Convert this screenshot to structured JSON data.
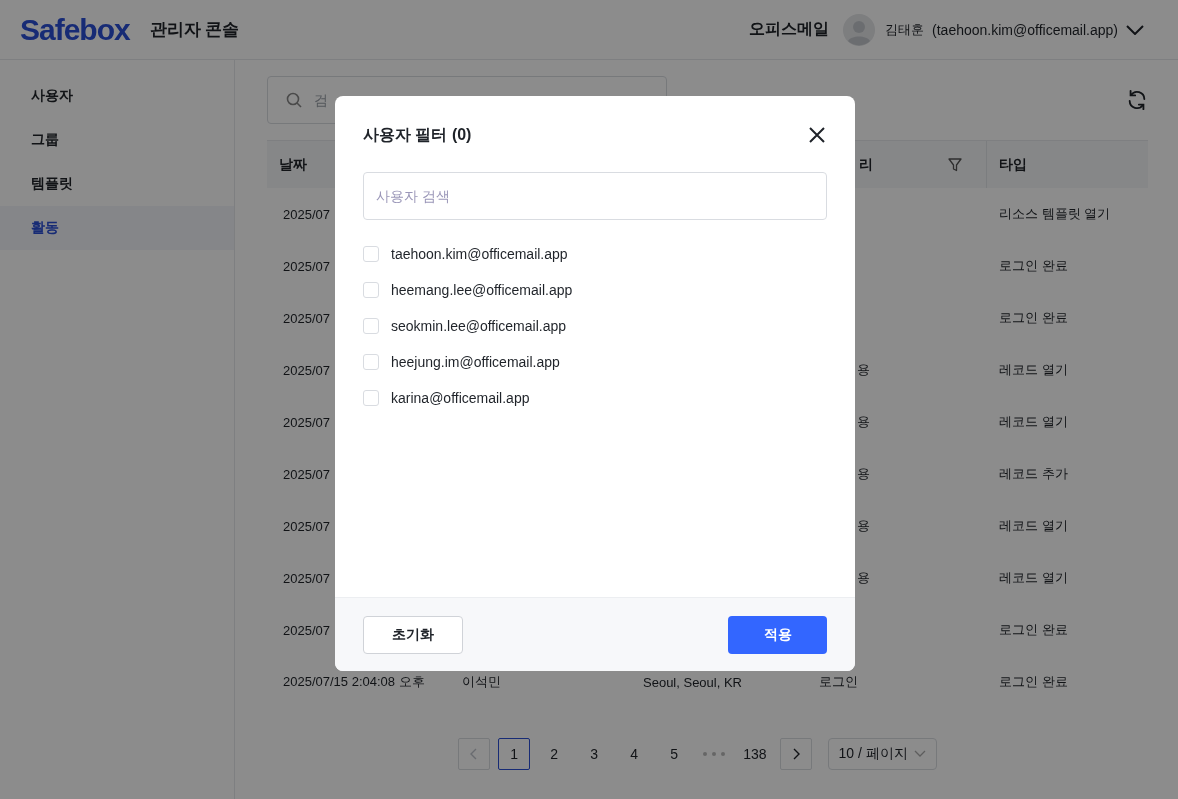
{
  "header": {
    "logo": "Safebox",
    "subtitle": "관리자 콘솔",
    "org": "오피스메일",
    "user_name": "김태훈",
    "user_email": "(taehoon.kim@officemail.app)"
  },
  "sidebar": {
    "items": [
      {
        "label": "사용자",
        "selected": false
      },
      {
        "label": "그룹",
        "selected": false
      },
      {
        "label": "템플릿",
        "selected": false
      },
      {
        "label": "활동",
        "selected": true
      }
    ]
  },
  "search": {
    "placeholder": "검"
  },
  "table": {
    "columns": {
      "date": "날짜",
      "category": "리",
      "type": "타입"
    },
    "rows": [
      {
        "date": "2025/07",
        "type": "리소스 템플릿 열기"
      },
      {
        "date": "2025/07",
        "type": "로그인 완료"
      },
      {
        "date": "2025/07",
        "type": "로그인 완료"
      },
      {
        "date": "2025/07",
        "category": "용",
        "type": "레코드 열기"
      },
      {
        "date": "2025/07",
        "category": "용",
        "type": "레코드 열기"
      },
      {
        "date": "2025/07",
        "category": "용",
        "type": "레코드 추가"
      },
      {
        "date": "2025/07",
        "category": "용",
        "type": "레코드 열기"
      },
      {
        "date": "2025/07",
        "category": "용",
        "type": "레코드 열기"
      },
      {
        "date": "2025/07",
        "type": "로그인 완료"
      },
      {
        "date": "2025/07/15 2:04:08 오후",
        "user": "이석민",
        "location": "Seoul, Seoul, KR",
        "category": "로그인",
        "type": "로그인 완료"
      }
    ]
  },
  "pagination": {
    "prev_disabled": true,
    "pages": [
      {
        "label": "1",
        "selected": true
      },
      {
        "label": "2",
        "selected": false
      },
      {
        "label": "3",
        "selected": false
      },
      {
        "label": "4",
        "selected": false
      },
      {
        "label": "5",
        "selected": false
      }
    ],
    "last_page": {
      "label": "138",
      "selected": false
    },
    "next_disabled": false,
    "page_size": "10 / 페이지"
  },
  "modal": {
    "title": "사용자 필터 (0)",
    "search_placeholder": "사용자 검색",
    "users": [
      {
        "email": "taehoon.kim@officemail.app",
        "checked": false
      },
      {
        "email": "heemang.lee@officemail.app",
        "checked": false
      },
      {
        "email": "seokmin.lee@officemail.app",
        "checked": false
      },
      {
        "email": "heejung.im@officemail.app",
        "checked": false
      },
      {
        "email": "karina@officemail.app",
        "checked": false
      }
    ],
    "reset_button": "초기화",
    "apply_button": "적용"
  }
}
